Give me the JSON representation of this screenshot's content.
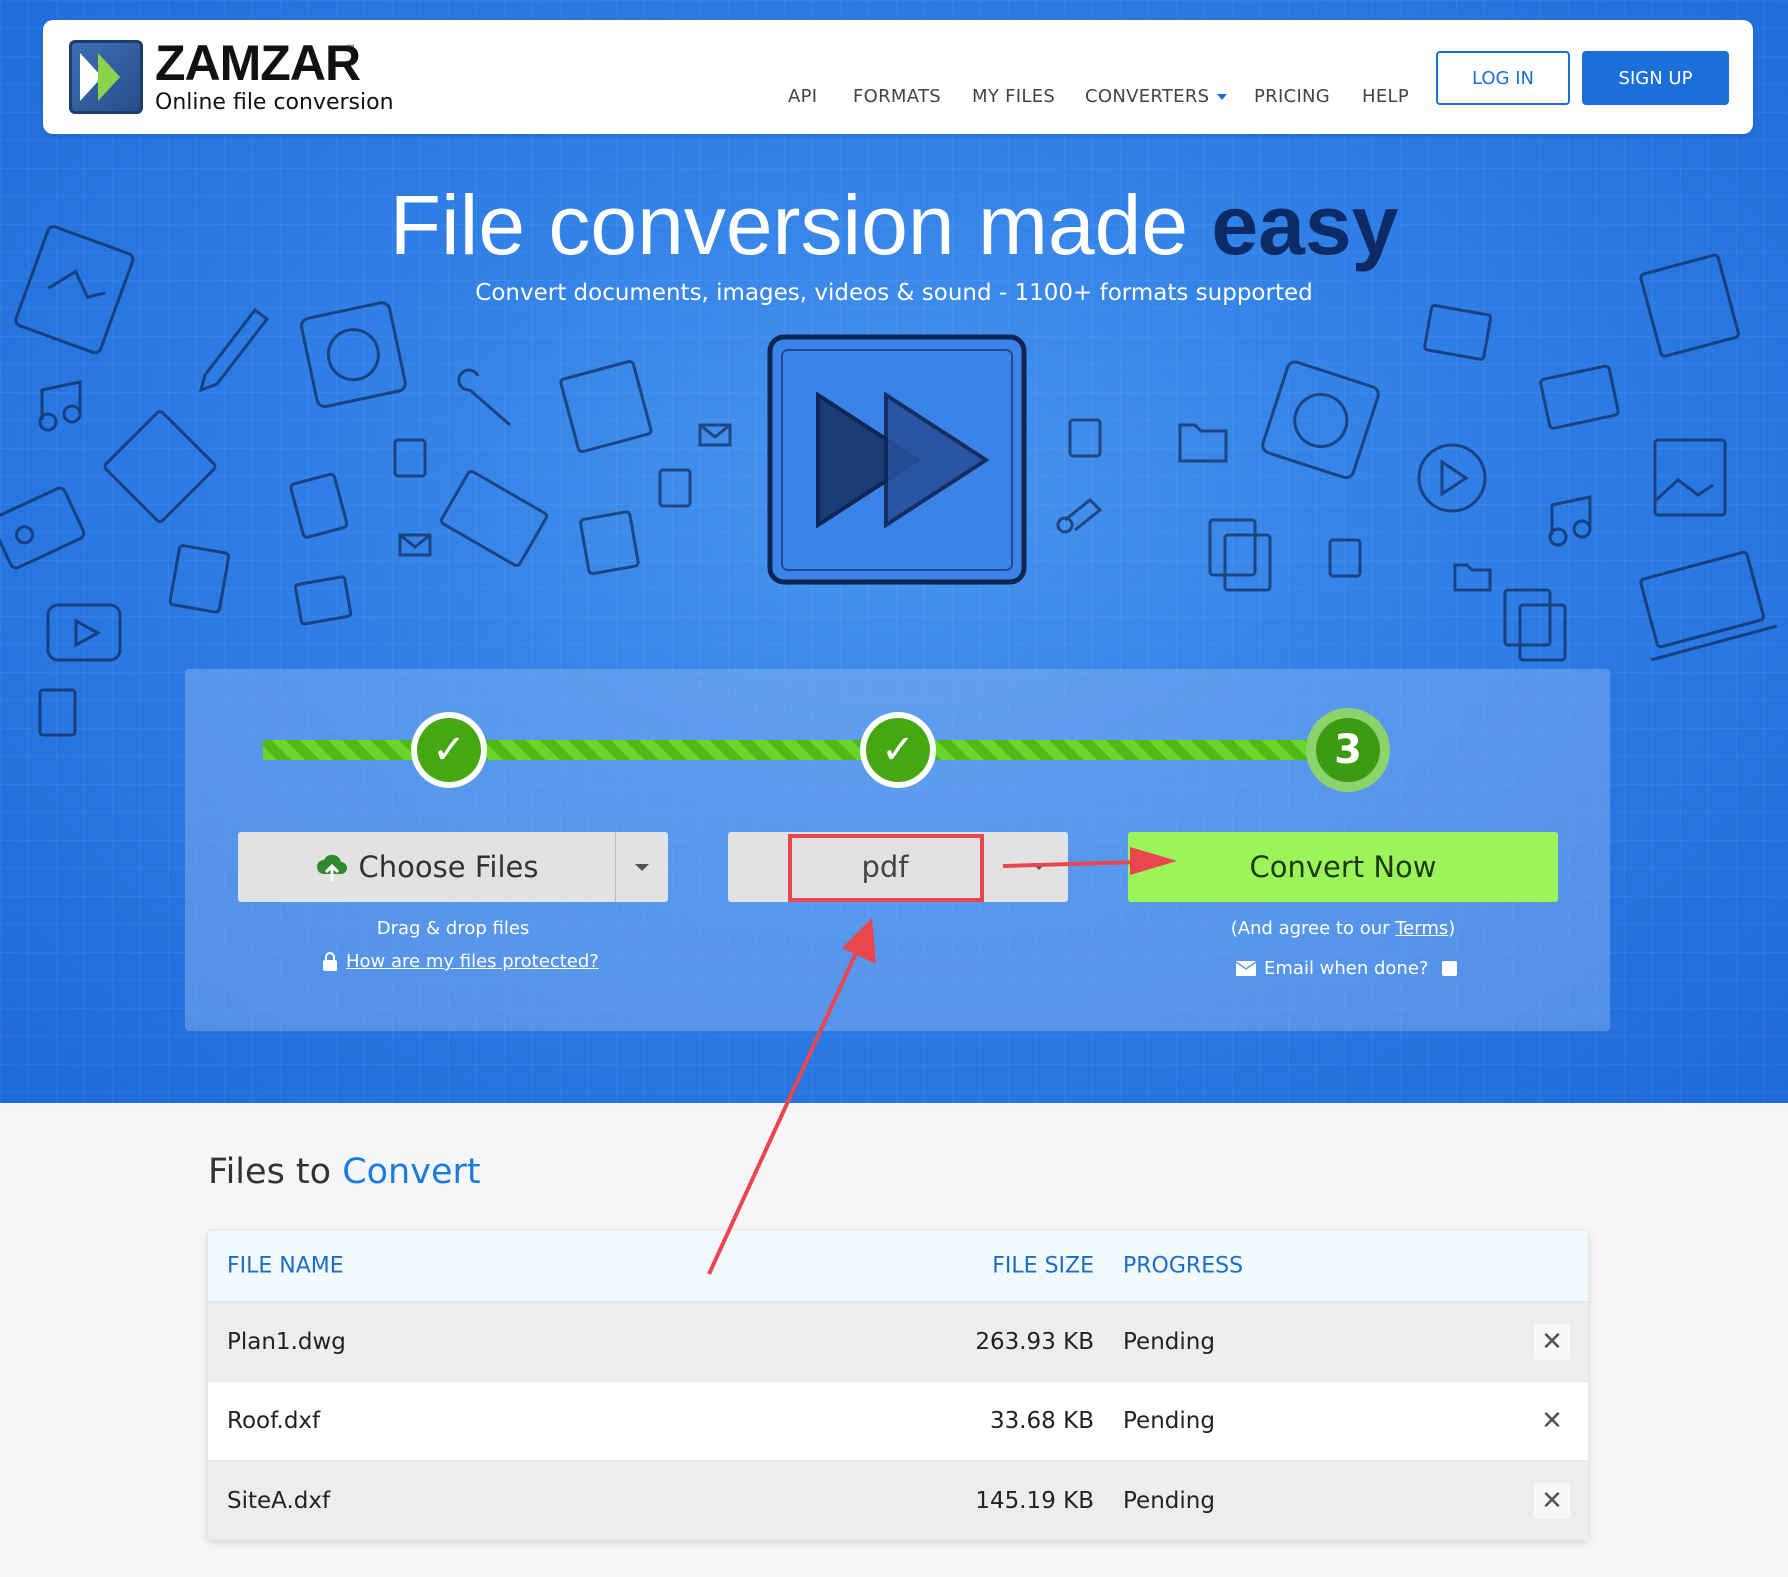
{
  "brand": {
    "name": "ZAMZAR",
    "tm": "™",
    "tagline": "Online file conversion"
  },
  "nav": {
    "items": [
      "API",
      "FORMATS",
      "MY FILES",
      "CONVERTERS",
      "PRICING",
      "HELP"
    ],
    "login": "LOG IN",
    "signup": "SIGN UP"
  },
  "hero": {
    "headline_main": "File conversion made ",
    "headline_bold": "easy",
    "subheadline": "Convert documents, images, videos & sound - 1100+ formats supported"
  },
  "steps": {
    "step3_label": "3",
    "done_mark": "✓"
  },
  "converter": {
    "choose_label": "Choose Files",
    "drag_text": "Drag & drop files",
    "protected_text": "How are my files protected?",
    "format_value": "pdf",
    "convert_label": "Convert Now",
    "agree_prefix": "(And agree to our ",
    "agree_link": "Terms",
    "agree_suffix": ")",
    "email_text": "Email when done?"
  },
  "files": {
    "title_a": "Files to ",
    "title_b": "Convert",
    "headers": {
      "name": "FILE NAME",
      "size": "FILE SIZE",
      "progress": "PROGRESS"
    },
    "rows": [
      {
        "name": "Plan1.dwg",
        "size": "263.93 KB",
        "progress": "Pending"
      },
      {
        "name": "Roof.dxf",
        "size": "33.68 KB",
        "progress": "Pending"
      },
      {
        "name": "SiteA.dxf",
        "size": "145.19 KB",
        "progress": "Pending"
      }
    ],
    "delete_glyph": "✕"
  },
  "colors": {
    "hero_blue": "#2f7fe6",
    "brand_blue": "#1b6fd8",
    "convert_green": "#9bf55a",
    "step_green": "#45a712",
    "annotation_red": "#e9464f"
  }
}
